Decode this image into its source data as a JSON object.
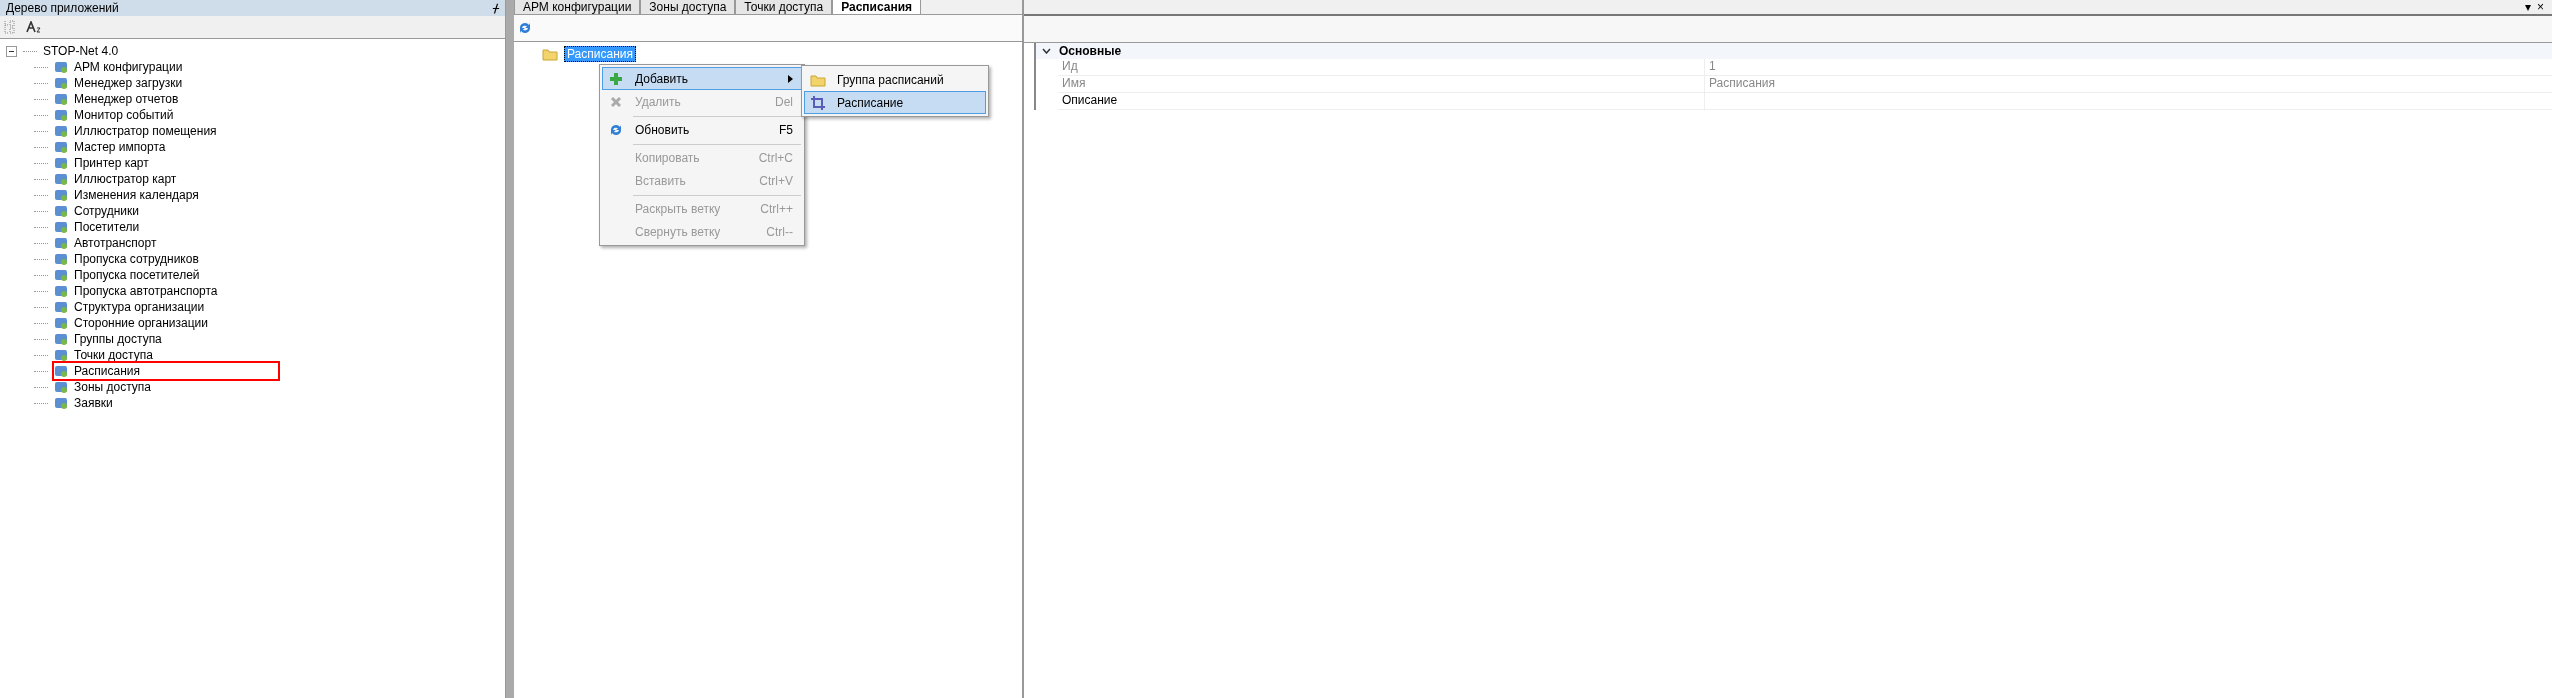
{
  "left_panel": {
    "title": "Дерево приложений",
    "pin": "ᚋ",
    "root": {
      "label": "STOP-Net 4.0",
      "expanded": true,
      "children": [
        {
          "label": "АРМ конфигурации",
          "highlighted": false
        },
        {
          "label": "Менеджер загрузки",
          "highlighted": false
        },
        {
          "label": "Менеджер отчетов",
          "highlighted": false
        },
        {
          "label": "Монитор событий",
          "highlighted": false
        },
        {
          "label": "Иллюстратор помещения",
          "highlighted": false
        },
        {
          "label": "Мастер импорта",
          "highlighted": false
        },
        {
          "label": "Принтер карт",
          "highlighted": false
        },
        {
          "label": "Иллюстратор карт",
          "highlighted": false
        },
        {
          "label": "Изменения календаря",
          "highlighted": false
        },
        {
          "label": "Сотрудники",
          "highlighted": false
        },
        {
          "label": "Посетители",
          "highlighted": false
        },
        {
          "label": "Автотранспорт",
          "highlighted": false
        },
        {
          "label": "Пропуска сотрудников",
          "highlighted": false
        },
        {
          "label": "Пропуска посетителей",
          "highlighted": false
        },
        {
          "label": "Пропуска автотранспорта",
          "highlighted": false
        },
        {
          "label": "Структура организации",
          "highlighted": false
        },
        {
          "label": "Сторонние организации",
          "highlighted": false
        },
        {
          "label": "Группы доступа",
          "highlighted": false
        },
        {
          "label": "Точки доступа",
          "highlighted": false
        },
        {
          "label": "Расписания",
          "highlighted": true
        },
        {
          "label": "Зоны доступа",
          "highlighted": false
        },
        {
          "label": "Заявки",
          "highlighted": false
        }
      ]
    }
  },
  "tabs": [
    {
      "label": "АРМ конфигурации",
      "selected": false
    },
    {
      "label": "Зоны доступа",
      "selected": false
    },
    {
      "label": "Точки доступа",
      "selected": false
    },
    {
      "label": "Расписания",
      "selected": true
    }
  ],
  "tree": {
    "node": {
      "label": "Расписания",
      "selected": true
    }
  },
  "context_menu": {
    "items": [
      {
        "kind": "add",
        "label": "Добавить",
        "disabled": false,
        "selected": true,
        "separator_before": false,
        "submenu": true
      },
      {
        "kind": "delete",
        "label": "Удалить",
        "shortcut": "Del",
        "disabled": true,
        "selected": false,
        "separator_before": false,
        "submenu": false
      },
      {
        "kind": "refresh",
        "label": "Обновить",
        "shortcut": "F5",
        "disabled": false,
        "selected": false,
        "separator_before": true,
        "submenu": false
      },
      {
        "kind": "plain",
        "label": "Копировать",
        "shortcut": "Ctrl+C",
        "disabled": true,
        "selected": false,
        "separator_before": true,
        "submenu": false
      },
      {
        "kind": "plain",
        "label": "Вставить",
        "shortcut": "Ctrl+V",
        "disabled": true,
        "selected": false,
        "separator_before": false,
        "submenu": false
      },
      {
        "kind": "plain",
        "label": "Раскрыть ветку",
        "shortcut": "Ctrl++",
        "disabled": true,
        "selected": false,
        "separator_before": true,
        "submenu": false
      },
      {
        "kind": "plain",
        "label": "Свернуть ветку",
        "shortcut": "Ctrl--",
        "disabled": true,
        "selected": false,
        "separator_before": false,
        "submenu": false
      }
    ]
  },
  "submenu": {
    "items": [
      {
        "kind": "folder",
        "label": "Группа расписаний",
        "selected": false
      },
      {
        "kind": "schedule",
        "label": "Расписание",
        "selected": true
      }
    ]
  },
  "right_panel": {
    "dropdown": "▾",
    "close": "×",
    "category": {
      "label": "Основные",
      "expanded": true
    },
    "properties": [
      {
        "name": "Ид",
        "value": "1",
        "readonly": true
      },
      {
        "name": "Имя",
        "value": "Расписания",
        "readonly": true
      },
      {
        "name": "Описание",
        "readonly": false
      }
    ]
  }
}
